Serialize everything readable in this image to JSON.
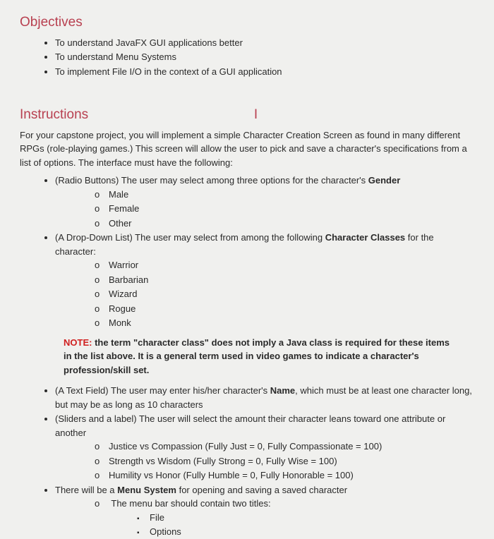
{
  "objectives": {
    "heading": "Objectives",
    "items": [
      "To understand JavaFX GUI applications better",
      "To understand Menu Systems",
      "To implement File I/O in the context of a GUI application"
    ]
  },
  "instructions": {
    "heading": "Instructions",
    "intro": "For your capstone project, you will implement a simple Character Creation Screen as found in many different RPGs (role-playing games.)  This screen will allow the user to pick and save a character's specifications from a list of options.  The interface must have the following:",
    "cursor": "I",
    "bullets": {
      "gender_pre": "(Radio Buttons)  The user may select among three options for the character's ",
      "gender_bold": "Gender",
      "gender_opts": [
        "Male",
        "Female",
        "Other"
      ],
      "class_pre": "(A Drop-Down List)  The user may select from among the following ",
      "class_bold": "Character Classes",
      "class_post": " for the character:",
      "class_opts": [
        "Warrior",
        "Barbarian",
        "Wizard",
        "Rogue",
        "Monk"
      ],
      "note_label": "NOTE:",
      "note_text": " the term \"character class\" does not imply a Java class is required for these items in the list above.  It is a general term used in video games to indicate a character's profession/skill set.",
      "name_pre": "(A Text Field)  The user may enter his/her character's ",
      "name_bold": "Name",
      "name_post": ", which must be at least one character long, but may be as long as 10 characters",
      "sliders": "(Sliders and a label) The user will select the amount their character leans toward one attribute or another",
      "slider_opts": [
        "Justice vs Compassion (Fully Just = 0, Fully Compassionate = 100)",
        "Strength vs Wisdom (Fully Strong = 0, Fully Wise = 100)",
        "Humility vs Honor (Fully Humble = 0, Fully Honorable = 100)"
      ],
      "menu_pre": "There will be a ",
      "menu_bold": "Menu System",
      "menu_post": " for opening and saving a saved character",
      "menu_sub": "The menu bar should contain two titles:",
      "menu_items": [
        "File",
        "Options"
      ]
    }
  }
}
